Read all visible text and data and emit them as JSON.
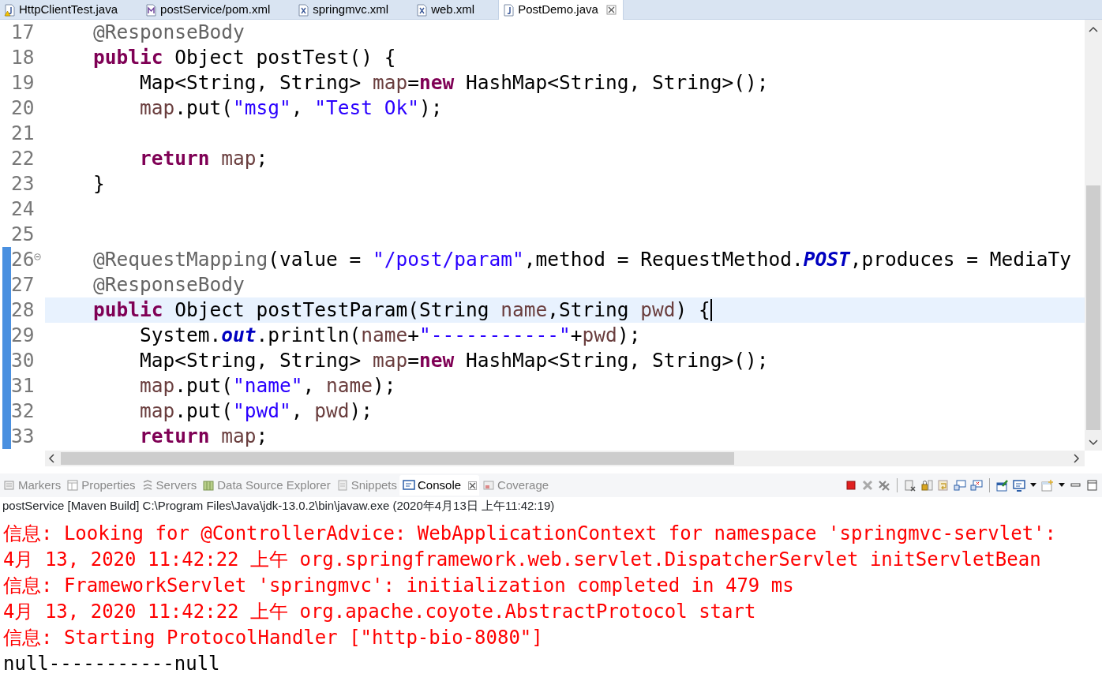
{
  "editor_tabs": [
    {
      "label": "HttpClientTest.java",
      "kind": "java",
      "selected": false,
      "warning": true
    },
    {
      "label": "postService/pom.xml",
      "kind": "pom",
      "selected": false,
      "warning": false
    },
    {
      "label": "springmvc.xml",
      "kind": "xml",
      "selected": false,
      "warning": false
    },
    {
      "label": "web.xml",
      "kind": "xml",
      "selected": false,
      "warning": false
    },
    {
      "label": "PostDemo.java",
      "kind": "java",
      "selected": true,
      "warning": false
    }
  ],
  "editor": {
    "lines": [
      {
        "number": "17",
        "changed": false,
        "current": false,
        "fold": false,
        "tokens": [
          {
            "kind": "ann",
            "text": "    @ResponseBody"
          }
        ]
      },
      {
        "number": "18",
        "changed": false,
        "current": false,
        "fold": false,
        "tokens": [
          {
            "kind": "kw",
            "text": "    public"
          },
          {
            "kind": "plain",
            "text": " Object postTest() {"
          }
        ]
      },
      {
        "number": "19",
        "changed": false,
        "current": false,
        "fold": false,
        "tokens": [
          {
            "kind": "plain",
            "text": "        Map<String, String> "
          },
          {
            "kind": "var",
            "text": "map"
          },
          {
            "kind": "plain",
            "text": "="
          },
          {
            "kind": "kw",
            "text": "new"
          },
          {
            "kind": "plain",
            "text": " HashMap<String, String>();"
          }
        ]
      },
      {
        "number": "20",
        "changed": false,
        "current": false,
        "fold": false,
        "tokens": [
          {
            "kind": "var",
            "text": "        map"
          },
          {
            "kind": "plain",
            "text": ".put("
          },
          {
            "kind": "str",
            "text": "\"msg\""
          },
          {
            "kind": "plain",
            "text": ", "
          },
          {
            "kind": "str",
            "text": "\"Test Ok\""
          },
          {
            "kind": "plain",
            "text": ");"
          }
        ]
      },
      {
        "number": "21",
        "changed": false,
        "current": false,
        "fold": false
      },
      {
        "number": "22",
        "changed": false,
        "current": false,
        "fold": false,
        "tokens": [
          {
            "kind": "kw",
            "text": "        return"
          },
          {
            "kind": "var",
            "text": " map"
          },
          {
            "kind": "plain",
            "text": ";"
          }
        ]
      },
      {
        "number": "23",
        "changed": false,
        "current": false,
        "fold": false,
        "tokens": [
          {
            "kind": "plain",
            "text": "    }"
          }
        ]
      },
      {
        "number": "24",
        "changed": false,
        "current": false,
        "fold": false
      },
      {
        "number": "25",
        "changed": false,
        "current": false,
        "fold": false
      },
      {
        "number": "26",
        "changed": true,
        "current": false,
        "fold": true,
        "tokens": [
          {
            "kind": "ann",
            "text": "    @RequestMapping"
          },
          {
            "kind": "plain",
            "text": "(value = "
          },
          {
            "kind": "str",
            "text": "\"/post/param\""
          },
          {
            "kind": "plain",
            "text": ",method = RequestMethod."
          },
          {
            "kind": "field",
            "text": "POST"
          },
          {
            "kind": "plain",
            "text": ",produces = MediaTy"
          }
        ]
      },
      {
        "number": "27",
        "changed": true,
        "current": false,
        "fold": false,
        "tokens": [
          {
            "kind": "ann",
            "text": "    @ResponseBody"
          }
        ]
      },
      {
        "number": "28",
        "changed": true,
        "current": true,
        "fold": false,
        "tokens": [
          {
            "kind": "kw",
            "text": "    public"
          },
          {
            "kind": "plain",
            "text": " Object postTestParam(String "
          },
          {
            "kind": "var",
            "text": "name"
          },
          {
            "kind": "plain",
            "text": ",String "
          },
          {
            "kind": "var",
            "text": "pwd"
          },
          {
            "kind": "plain",
            "text": ") {"
          }
        ]
      },
      {
        "number": "29",
        "changed": true,
        "current": false,
        "fold": false,
        "tokens": [
          {
            "kind": "plain",
            "text": "        System."
          },
          {
            "kind": "field",
            "text": "out"
          },
          {
            "kind": "plain",
            "text": ".println("
          },
          {
            "kind": "var",
            "text": "name"
          },
          {
            "kind": "plain",
            "text": "+"
          },
          {
            "kind": "str",
            "text": "\"-----------\""
          },
          {
            "kind": "plain",
            "text": "+"
          },
          {
            "kind": "var",
            "text": "pwd"
          },
          {
            "kind": "plain",
            "text": ");"
          }
        ]
      },
      {
        "number": "30",
        "changed": true,
        "current": false,
        "fold": false,
        "tokens": [
          {
            "kind": "plain",
            "text": "        Map<String, String> "
          },
          {
            "kind": "var",
            "text": "map"
          },
          {
            "kind": "plain",
            "text": "="
          },
          {
            "kind": "kw",
            "text": "new"
          },
          {
            "kind": "plain",
            "text": " HashMap<String, String>();"
          }
        ]
      },
      {
        "number": "31",
        "changed": true,
        "current": false,
        "fold": false,
        "tokens": [
          {
            "kind": "var",
            "text": "        map"
          },
          {
            "kind": "plain",
            "text": ".put("
          },
          {
            "kind": "str",
            "text": "\"name\""
          },
          {
            "kind": "plain",
            "text": ", "
          },
          {
            "kind": "var",
            "text": "name"
          },
          {
            "kind": "plain",
            "text": ");"
          }
        ]
      },
      {
        "number": "32",
        "changed": true,
        "current": false,
        "fold": false,
        "tokens": [
          {
            "kind": "var",
            "text": "        map"
          },
          {
            "kind": "plain",
            "text": ".put("
          },
          {
            "kind": "str",
            "text": "\"pwd\""
          },
          {
            "kind": "plain",
            "text": ", "
          },
          {
            "kind": "var",
            "text": "pwd"
          },
          {
            "kind": "plain",
            "text": ");"
          }
        ]
      },
      {
        "number": "33",
        "changed": true,
        "current": false,
        "fold": false,
        "tokens": [
          {
            "kind": "kw",
            "text": "        return"
          },
          {
            "kind": "var",
            "text": " map"
          },
          {
            "kind": "plain",
            "text": ";"
          }
        ]
      }
    ]
  },
  "view_tabs": [
    {
      "label": "Markers",
      "kind": "markers",
      "selected": false
    },
    {
      "label": "Properties",
      "kind": "properties",
      "selected": false
    },
    {
      "label": "Servers",
      "kind": "servers",
      "selected": false
    },
    {
      "label": "Data Source Explorer",
      "kind": "datasource",
      "selected": false
    },
    {
      "label": "Snippets",
      "kind": "snippets",
      "selected": false
    },
    {
      "label": "Console",
      "kind": "console",
      "selected": true
    },
    {
      "label": "Coverage",
      "kind": "coverage",
      "selected": false
    }
  ],
  "console": {
    "header": "postService [Maven Build] C:\\Program Files\\Java\\jdk-13.0.2\\bin\\javaw.exe (2020年4月13日 上午11:42:19)",
    "lines": [
      {
        "kind": "err",
        "text": "信息: Looking for @ControllerAdvice: WebApplicationContext for namespace 'springmvc-servlet':"
      },
      {
        "kind": "err",
        "text": "4月 13, 2020 11:42:22 上午 org.springframework.web.servlet.DispatcherServlet initServletBean"
      },
      {
        "kind": "err",
        "text": "信息: FrameworkServlet 'springmvc': initialization completed in 479 ms"
      },
      {
        "kind": "err",
        "text": "4月 13, 2020 11:42:22 上午 org.apache.coyote.AbstractProtocol start"
      },
      {
        "kind": "err",
        "text": "信息: Starting ProtocolHandler [\"http-bio-8080\"]"
      },
      {
        "kind": "out",
        "text": "null-----------null"
      }
    ]
  }
}
